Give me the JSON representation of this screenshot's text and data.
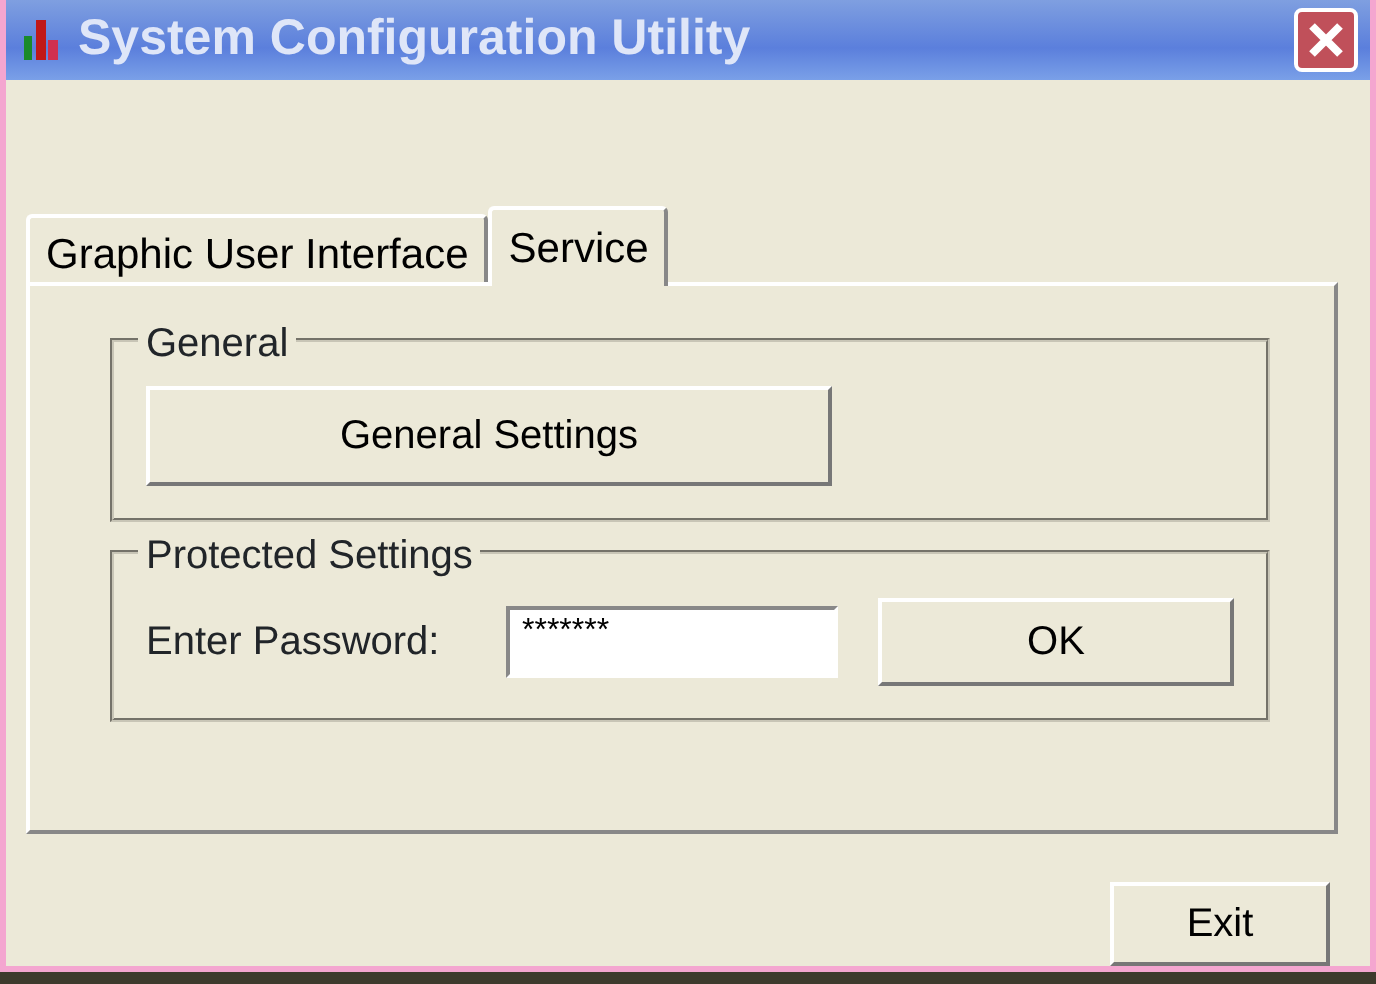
{
  "window": {
    "title": "System Configuration Utility"
  },
  "tabs": [
    {
      "label": "Graphic User Interface",
      "selected": false
    },
    {
      "label": "Service",
      "selected": true
    }
  ],
  "general": {
    "title": "General",
    "button": "General Settings"
  },
  "protected": {
    "title": "Protected Settings",
    "label": "Enter Password:",
    "value": "*******",
    "button": "OK"
  },
  "buttons": [
    "Exit"
  ]
}
